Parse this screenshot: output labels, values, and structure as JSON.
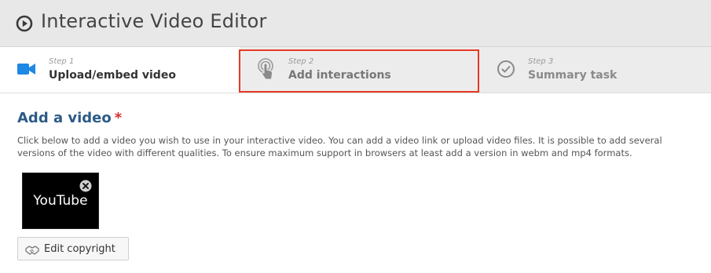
{
  "header": {
    "title": "Interactive Video Editor",
    "icon": "play-circle-icon"
  },
  "steps": [
    {
      "number": "Step 1",
      "label": "Upload/embed video",
      "icon": "video-camera-icon",
      "active": true
    },
    {
      "number": "Step 2",
      "label": "Add interactions",
      "icon": "touch-icon",
      "active": false
    },
    {
      "number": "Step 3",
      "label": "Summary task",
      "icon": "check-circle-icon",
      "active": false
    }
  ],
  "section": {
    "title": "Add a video",
    "required_marker": "*",
    "description": "Click below to add a video you wish to use in your interactive video. You can add a video link or upload video files. It is possible to add several versions of the video with different qualities. To ensure maximum support in browsers at least add a version in webm and mp4 formats."
  },
  "video": {
    "label": "YouTube",
    "remove_icon": "close-circle-icon"
  },
  "copyright_button": {
    "label": "Edit copyright",
    "icon": "handshake-icon"
  },
  "colors": {
    "accent_title": "#2c5a86",
    "active_step_icon": "#1e88e5",
    "highlight": "#e63a24",
    "required": "#d32f2f"
  }
}
